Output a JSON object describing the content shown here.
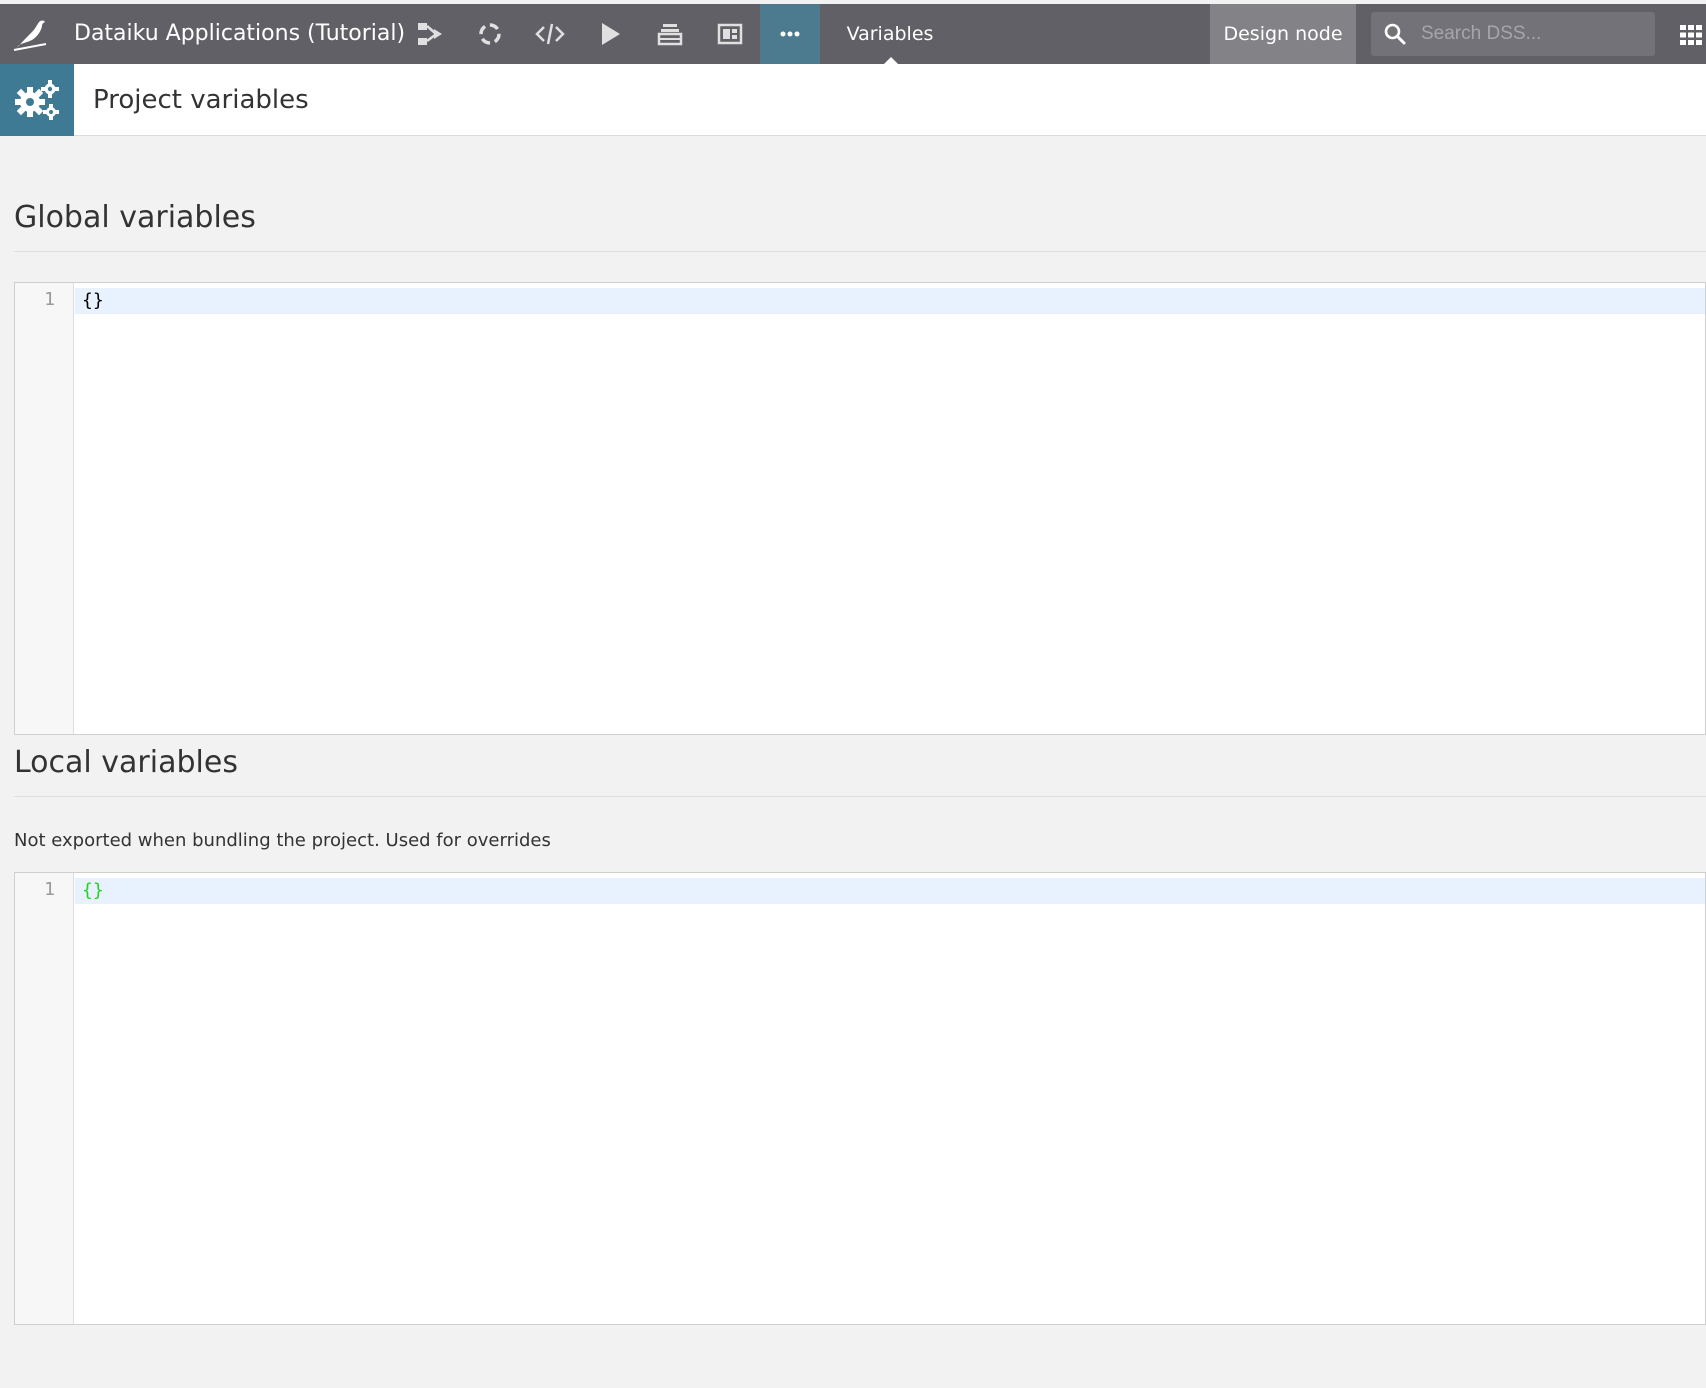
{
  "topbar": {
    "project_name": "Dataiku Applications (Tutorial)",
    "nav_icons": [
      "flow-icon",
      "lab-icon",
      "code-icon",
      "run-icon",
      "stack-icon",
      "dashboard-icon",
      "more-icon"
    ],
    "context_label": "Variables",
    "design_node_label": "Design node",
    "search_placeholder": "Search DSS...",
    "colors": {
      "bar": "#606066",
      "active_item": "#4c7b8f",
      "design_node": "#828287"
    }
  },
  "page": {
    "title": "Project variables",
    "icon": "gears-icon",
    "icon_background": "#3e7a94"
  },
  "global_section": {
    "title": "Global variables",
    "editor": {
      "line_number": "1",
      "code": "{}"
    }
  },
  "local_section": {
    "title": "Local variables",
    "help_text": "Not exported when bundling the project. Used for overrides",
    "editor": {
      "line_number": "1",
      "code": "{}",
      "bracket_match_color": "#22d322"
    }
  }
}
